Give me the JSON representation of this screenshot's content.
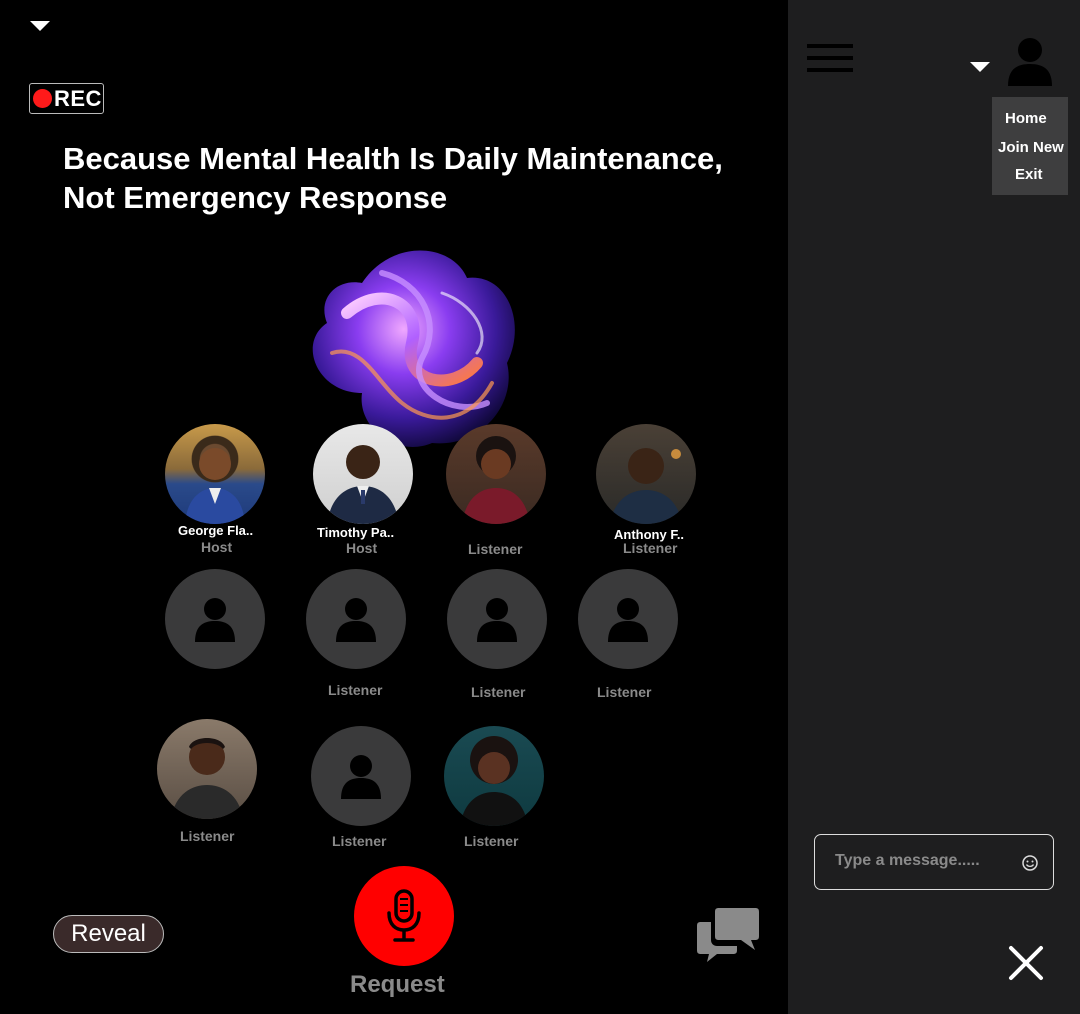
{
  "main": {
    "record_label": "REC",
    "headline": "Because Mental Health Is Daily Maintenance, Not Emergency Response",
    "participants": [
      {
        "name": "George Fla..",
        "role": "Host"
      },
      {
        "name": "Timothy Pa..",
        "role": "Host"
      },
      {
        "name": "",
        "role": "Listener"
      },
      {
        "name": "Anthony F..",
        "role": "Listener"
      },
      {
        "name": "",
        "role": "Listener"
      },
      {
        "name": "",
        "role": "Listener"
      },
      {
        "name": "",
        "role": "Listener"
      },
      {
        "name": "",
        "role": "Listener"
      },
      {
        "name": "",
        "role": "Listener"
      },
      {
        "name": "",
        "role": "Listener"
      },
      {
        "name": "",
        "role": "Listener"
      }
    ],
    "reveal_label": "Reveal",
    "request_label": "Request"
  },
  "sidebar": {
    "menu_items": [
      "Home",
      "Join New",
      "Exit"
    ],
    "message_placeholder": "Type a message....."
  },
  "colors": {
    "record_dot": "#ff1a1a",
    "mic_button": "#ff0000",
    "sidebar_bg": "#1e1e1f",
    "empty_avatar": "#3a3a3b"
  },
  "icons": [
    "caret-down-icon",
    "record-dot-icon",
    "microphone-icon",
    "chat-bubbles-icon",
    "hamburger-icon",
    "user-profile-icon",
    "emoji-icon",
    "close-icon"
  ]
}
